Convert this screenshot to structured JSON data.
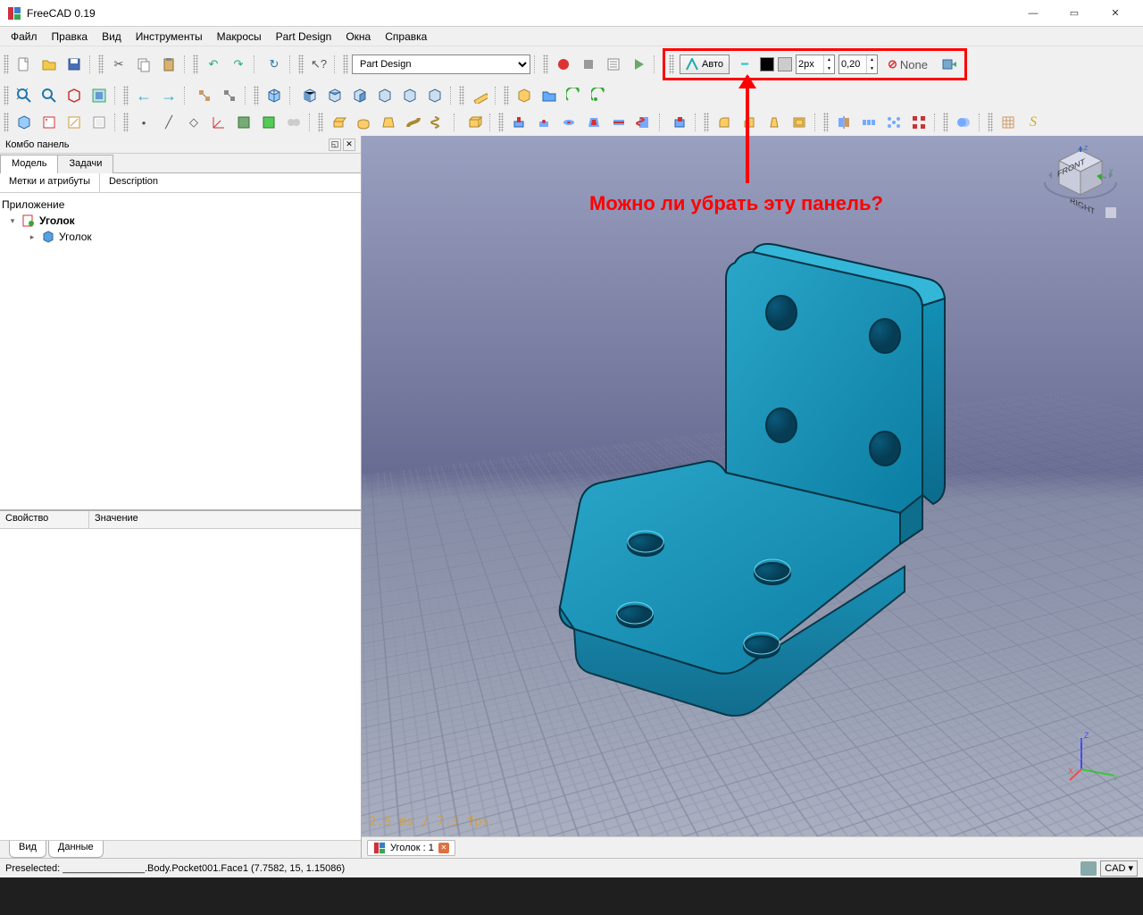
{
  "app": {
    "title": "FreeCAD 0.19"
  },
  "menu": {
    "items": [
      "Файл",
      "Правка",
      "Вид",
      "Инструменты",
      "Макросы",
      "Part Design",
      "Окна",
      "Справка"
    ]
  },
  "workbench": {
    "selected": "Part Design"
  },
  "draftbar": {
    "auto_label": "Авто",
    "linewidth": "2px",
    "transparency": "0,20",
    "none_label": "None"
  },
  "combo": {
    "title": "Комбо панель",
    "tabs": {
      "model": "Модель",
      "tasks": "Задачи"
    },
    "subtabs": {
      "labels": "Метки и атрибуты",
      "description": "Description"
    },
    "tree": {
      "root": "Приложение",
      "doc": "Уголок",
      "body": "Уголок"
    },
    "prop_headers": {
      "property": "Свойство",
      "value": "Значение"
    },
    "bottabs": {
      "view": "Вид",
      "data": "Данные"
    }
  },
  "annotation": {
    "text": "Можно ли убрать эту панель?"
  },
  "viewport": {
    "perf": "2.5 ms / 7.3 fps"
  },
  "docs": {
    "tab1": "Уголок : 1"
  },
  "status": {
    "preselect": "Preselected: _______________.Body.Pocket001.Face1 (7.7582, 15, 1.15086)",
    "mode": "CAD"
  },
  "axis_labels": {
    "x": "X",
    "y": "Y",
    "z": "Z"
  },
  "navcube": {
    "front": "FRONT",
    "right": "RIGHT"
  }
}
